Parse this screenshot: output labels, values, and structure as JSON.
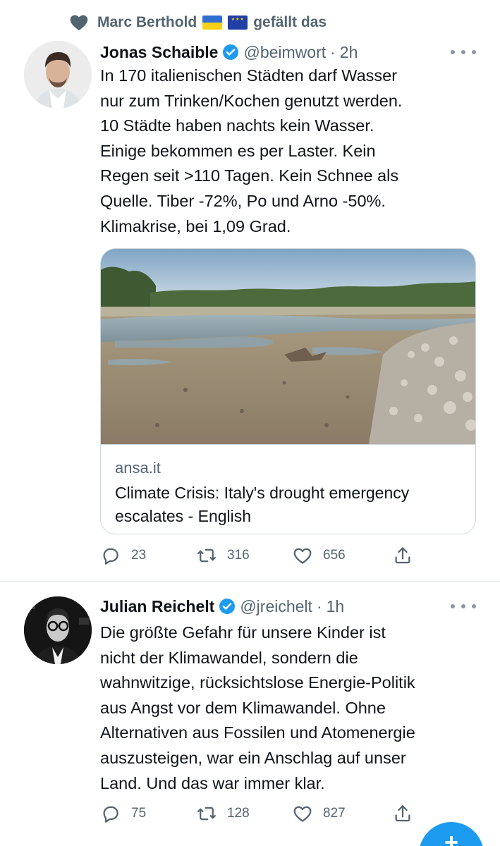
{
  "social_context": {
    "liker": "Marc Berthold",
    "suffix": "gefällt das",
    "icon": "heart-icon",
    "flags": [
      "ukraine-flag",
      "eu-flag"
    ]
  },
  "tweets": [
    {
      "display_name": "Jonas Schaible",
      "handle": "@beimwort",
      "separator": "·",
      "time": "2h",
      "verified": true,
      "text": "In 170 italienischen Städten darf Wasser\nnur zum Trinken/Kochen genutzt werden.\n10 Städte haben nachts kein Wasser.\nEinige bekommen es per Laster. Kein\nRegen seit >110 Tagen. Kein Schnee als\nQuelle. Tiber -72%, Po und Arno -50%.\nKlimakrise, bei 1,09 Grad.",
      "card": {
        "domain": "ansa.it",
        "title": "Climate Crisis: Italy's drought emergency escalates - English"
      },
      "replies": "23",
      "retweets": "316",
      "likes": "656"
    },
    {
      "display_name": "Julian Reichelt",
      "handle": "@jreichelt",
      "separator": "·",
      "time": "1h",
      "verified": true,
      "text": "Die größte Gefahr für unsere Kinder ist\nnicht der Klimawandel, sondern die\nwahnwitzige, rücksichtslose Energie-Politik\naus Angst vor dem Klimawandel. Ohne\nAlternativen aus Fossilen und Atomenergie\nauszusteigen, war ein Anschlag auf unser\nLand. Und das war immer klar.",
      "replies": "75",
      "retweets": "128",
      "likes": "827"
    }
  ],
  "colors": {
    "primary_text": "#0f1419",
    "secondary_text": "#536471",
    "verified_blue": "#1d9bf0",
    "border": "#cfd9de"
  },
  "fab": {
    "icon": "compose-plus-icon",
    "label": "+"
  }
}
